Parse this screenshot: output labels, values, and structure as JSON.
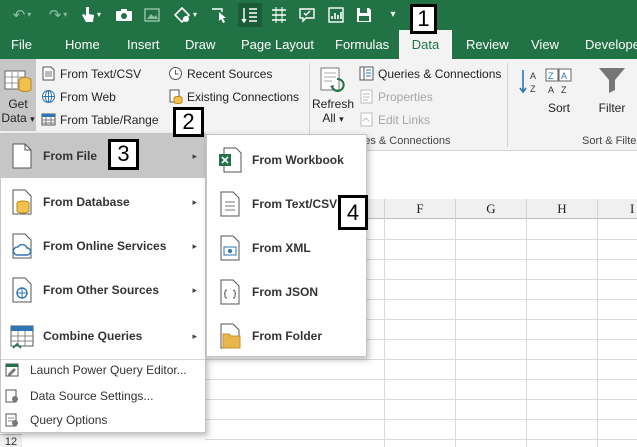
{
  "tabs": [
    "File",
    "Home",
    "Insert",
    "Draw",
    "Page Layout",
    "Formulas",
    "Data",
    "Review",
    "View",
    "Developer"
  ],
  "active_tab": "Data",
  "ribbon": {
    "get_data": {
      "line1": "Get",
      "line2": "Data",
      "arrow": "▾"
    },
    "from_text_csv": "From Text/CSV",
    "from_web": "From Web",
    "from_table_range": "From Table/Range",
    "recent_sources": "Recent Sources",
    "existing_connections": "Existing Connections",
    "refresh_all": {
      "line1": "Refresh",
      "line2": "All",
      "arrow": "▾"
    },
    "queries_connections": "Queries & Connections",
    "properties": "Properties",
    "edit_links": "Edit Links",
    "group_queries_label": "eries & Connections",
    "sort": "Sort",
    "filter": "Filter",
    "group_sort_label": "Sort & Filte"
  },
  "menu": {
    "items": [
      {
        "label": "From File",
        "arrow": "▸"
      },
      {
        "label": "From Database",
        "arrow": "▸"
      },
      {
        "label": "From Online Services",
        "arrow": "▸"
      },
      {
        "label": "From Other Sources",
        "arrow": "▸"
      },
      {
        "label": "Combine Queries",
        "arrow": "▸"
      }
    ],
    "launch_pq": "Launch Power Query Editor...",
    "data_source_settings": "Data Source Settings...",
    "query_options": "Query Options"
  },
  "submenu": {
    "items": [
      "From Workbook",
      "From Text/CSV",
      "From XML",
      "From JSON",
      "From Folder"
    ]
  },
  "columns": [
    "F",
    "G",
    "H",
    "I"
  ],
  "row_number": "12",
  "callouts": [
    "1",
    "2",
    "3",
    "4"
  ],
  "colors": {
    "excel_green": "#217346",
    "ribbon_bg": "#f3f3f3",
    "hover": "#c6c6c6"
  }
}
